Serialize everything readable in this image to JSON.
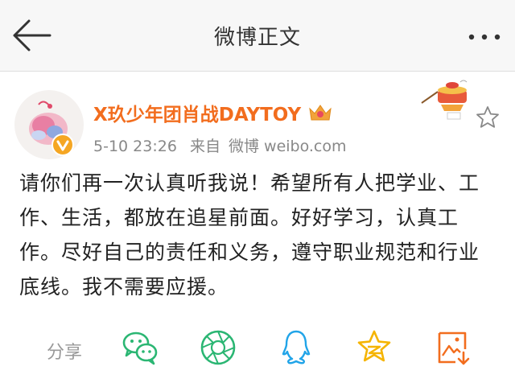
{
  "nav": {
    "title": "微博正文",
    "back_icon": "back-arrow-icon",
    "more_icon": "more-dots-icon"
  },
  "post": {
    "username": "X玖少年团肖战DAYTOY",
    "timestamp": "5-10 23:26",
    "source_prefix": "来自",
    "source": "微博 weibo.com",
    "content": "请你们再一次认真听我说！希望所有人把学业、工作、生活，都放在追星前面。好好学习，认真工作。尽好自己的责任和义务，遵守职业规范和行业底线。我不需要应援。",
    "username_color": "#f26d1e"
  },
  "share": {
    "label": "分享",
    "targets": [
      "wechat-icon",
      "moments-icon",
      "qq-icon",
      "qzone-icon",
      "save-image-icon"
    ]
  },
  "colors": {
    "green": "#2bb673",
    "qq_blue": "#21a4e8",
    "qzone_yellow": "#f5b400",
    "orange": "#f26d1e"
  }
}
